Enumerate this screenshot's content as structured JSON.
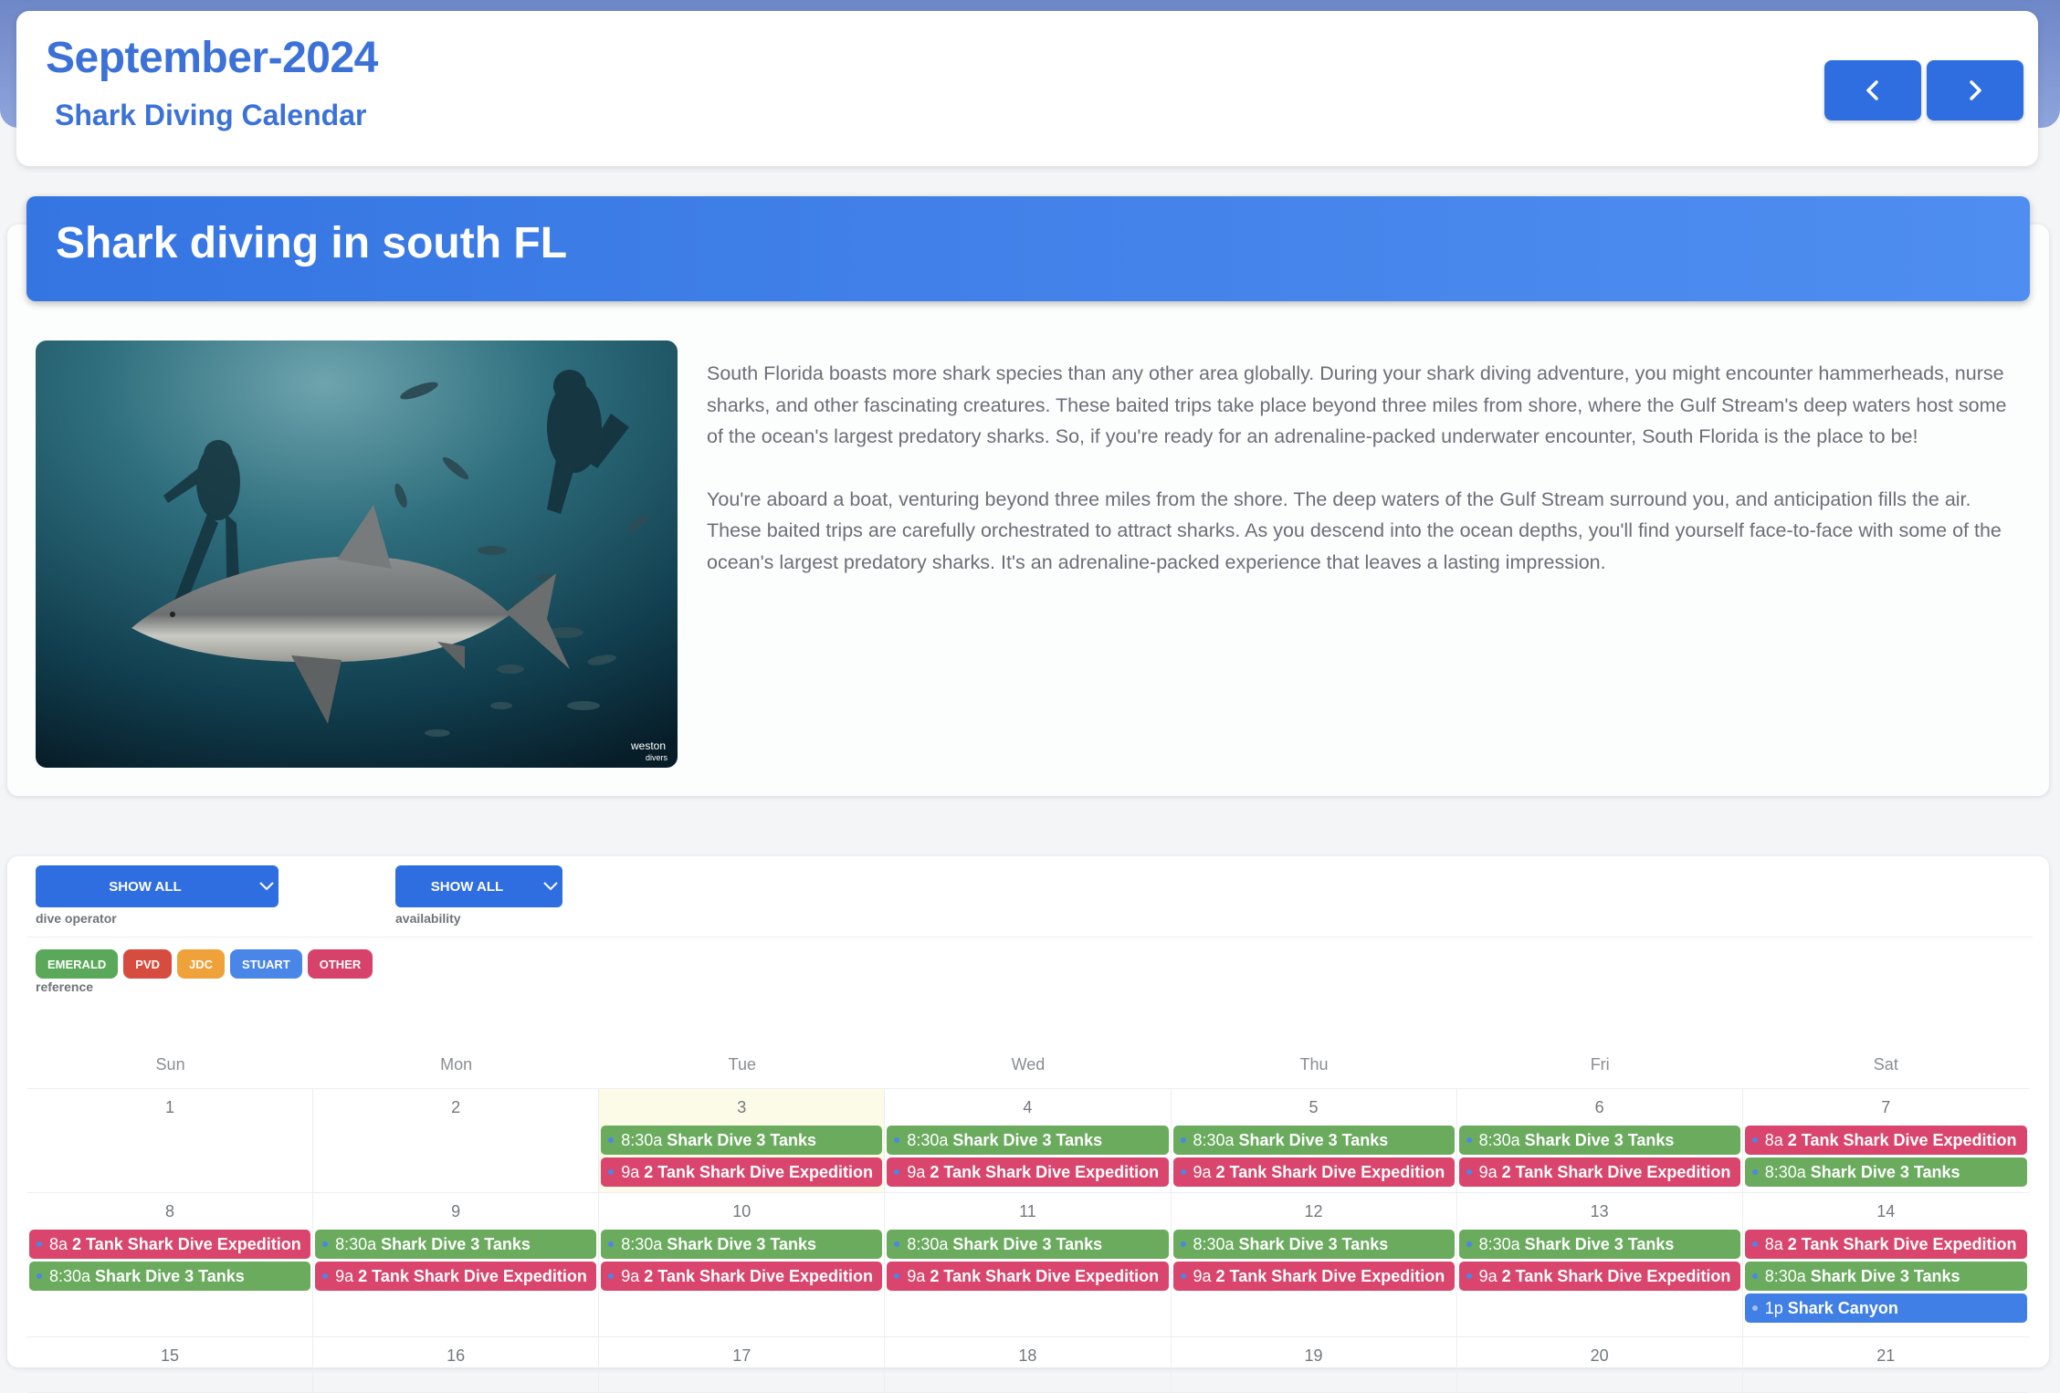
{
  "header": {
    "month_title": "September-2024",
    "subtitle": "Shark Diving Calendar"
  },
  "banner": {
    "title": "Shark diving in south FL"
  },
  "description": {
    "p1": "South Florida boasts more shark species than any other area globally. During your shark diving adventure, you might encounter hammerheads, nurse sharks, and other fascinating creatures. These baited trips take place beyond three miles from shore, where the Gulf Stream's deep waters host some of the ocean's largest predatory sharks. So, if you're ready for an adrenaline-packed underwater encounter, South Florida is the place to be!",
    "p2": "You're aboard a boat, venturing beyond three miles from the shore. The deep waters of the Gulf Stream surround you, and anticipation fills the air. These baited trips are carefully orchestrated to attract sharks. As you descend into the ocean depths, you'll find yourself face-to-face with some of the ocean's largest predatory sharks. It's an adrenaline-packed experience that leaves a lasting impression."
  },
  "photo": {
    "watermark_line1": "weston",
    "watermark_line2": "divers"
  },
  "filters": {
    "operator_value": "SHOW ALL",
    "operator_label": "dive operator",
    "availability_value": "SHOW ALL",
    "availability_label": "availability"
  },
  "reference": {
    "label": "reference",
    "badges": [
      {
        "label": "EMERALD",
        "color": "#5aa85a"
      },
      {
        "label": "PVD",
        "color": "#d64c3f"
      },
      {
        "label": "JDC",
        "color": "#f0a23a"
      },
      {
        "label": "STUART",
        "color": "#4a86e8"
      },
      {
        "label": "OTHER",
        "color": "#d6426a"
      }
    ]
  },
  "colors": {
    "green": "#6aab5e",
    "red": "#d9456d",
    "blue": "#3f7fe6",
    "today_bg": "#fcfbe8"
  },
  "calendar": {
    "days_of_week": [
      "Sun",
      "Mon",
      "Tue",
      "Wed",
      "Thu",
      "Fri",
      "Sat"
    ],
    "weeks": [
      {
        "days": [
          {
            "num": "1",
            "events": []
          },
          {
            "num": "2",
            "events": []
          },
          {
            "num": "3",
            "today": true,
            "events": [
              {
                "time": "8:30a",
                "name": "Shark Dive 3 Tanks",
                "color": "green"
              },
              {
                "time": "9a",
                "name": "2 Tank Shark Dive Expedition",
                "color": "red"
              }
            ]
          },
          {
            "num": "4",
            "events": [
              {
                "time": "8:30a",
                "name": "Shark Dive 3 Tanks",
                "color": "green"
              },
              {
                "time": "9a",
                "name": "2 Tank Shark Dive Expedition",
                "color": "red"
              }
            ]
          },
          {
            "num": "5",
            "events": [
              {
                "time": "8:30a",
                "name": "Shark Dive 3 Tanks",
                "color": "green"
              },
              {
                "time": "9a",
                "name": "2 Tank Shark Dive Expedition",
                "color": "red"
              }
            ]
          },
          {
            "num": "6",
            "events": [
              {
                "time": "8:30a",
                "name": "Shark Dive 3 Tanks",
                "color": "green"
              },
              {
                "time": "9a",
                "name": "2 Tank Shark Dive Expedition",
                "color": "red"
              }
            ]
          },
          {
            "num": "7",
            "events": [
              {
                "time": "8a",
                "name": "2 Tank Shark Dive Expedition",
                "color": "red"
              },
              {
                "time": "8:30a",
                "name": "Shark Dive 3 Tanks",
                "color": "green"
              }
            ]
          }
        ]
      },
      {
        "days": [
          {
            "num": "8",
            "events": [
              {
                "time": "8a",
                "name": "2 Tank Shark Dive Expedition",
                "color": "red"
              },
              {
                "time": "8:30a",
                "name": "Shark Dive 3 Tanks",
                "color": "green"
              }
            ]
          },
          {
            "num": "9",
            "events": [
              {
                "time": "8:30a",
                "name": "Shark Dive 3 Tanks",
                "color": "green"
              },
              {
                "time": "9a",
                "name": "2 Tank Shark Dive Expedition",
                "color": "red"
              }
            ]
          },
          {
            "num": "10",
            "events": [
              {
                "time": "8:30a",
                "name": "Shark Dive 3 Tanks",
                "color": "green"
              },
              {
                "time": "9a",
                "name": "2 Tank Shark Dive Expedition",
                "color": "red"
              }
            ]
          },
          {
            "num": "11",
            "events": [
              {
                "time": "8:30a",
                "name": "Shark Dive 3 Tanks",
                "color": "green"
              },
              {
                "time": "9a",
                "name": "2 Tank Shark Dive Expedition",
                "color": "red"
              }
            ]
          },
          {
            "num": "12",
            "events": [
              {
                "time": "8:30a",
                "name": "Shark Dive 3 Tanks",
                "color": "green"
              },
              {
                "time": "9a",
                "name": "2 Tank Shark Dive Expedition",
                "color": "red"
              }
            ]
          },
          {
            "num": "13",
            "events": [
              {
                "time": "8:30a",
                "name": "Shark Dive 3 Tanks",
                "color": "green"
              },
              {
                "time": "9a",
                "name": "2 Tank Shark Dive Expedition",
                "color": "red"
              }
            ]
          },
          {
            "num": "14",
            "events": [
              {
                "time": "8a",
                "name": "2 Tank Shark Dive Expedition",
                "color": "red"
              },
              {
                "time": "8:30a",
                "name": "Shark Dive 3 Tanks",
                "color": "green"
              },
              {
                "time": "1p",
                "name": "Shark Canyon",
                "color": "blue"
              }
            ]
          }
        ]
      },
      {
        "days": [
          {
            "num": "15",
            "events": []
          },
          {
            "num": "16",
            "events": []
          },
          {
            "num": "17",
            "events": []
          },
          {
            "num": "18",
            "events": []
          },
          {
            "num": "19",
            "events": []
          },
          {
            "num": "20",
            "events": []
          },
          {
            "num": "21",
            "events": []
          }
        ]
      }
    ]
  }
}
